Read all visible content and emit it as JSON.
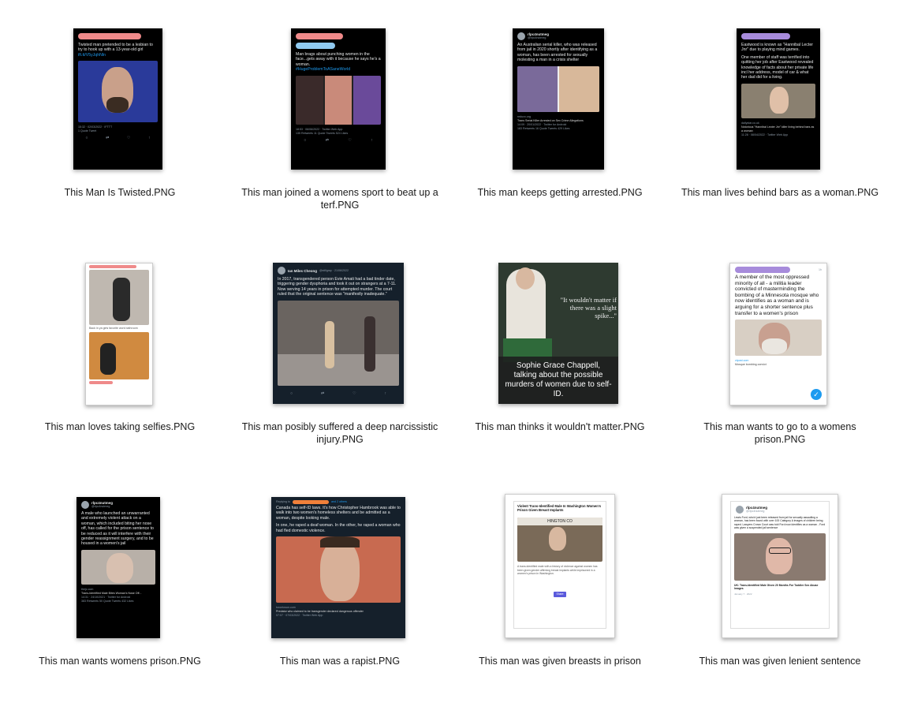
{
  "files": [
    {
      "label": "This Man Is Twisted.PNG",
      "tweet": "Twisted man pretended to be a lesbian to try to hook up with a 13-year-old girl",
      "link": "ift.tt/V5yJqhNln",
      "meta": "15:32 · 02/03/2022 · IFTTT",
      "stats": "1 Quote Tweet"
    },
    {
      "label": "This man joined a womens sport to beat up a terf.PNG",
      "tweet": "Man brags about punching women in the face...gets away with it because he says he's a woman.",
      "hashtag": "#HugeProblemToASaneWorld",
      "meta": "18:53 · 06/06/2022 · Twitter Web App",
      "stats": "135 Retweets  11 Quote Tweets  524 Likes"
    },
    {
      "label": "This man keeps getting arrested.PNG",
      "user": "rlpc4nutmeg",
      "handle": "@rlpc4nutmeg",
      "tweet": "An Australian serial killer, who was released from jail in 2020 shortly after identifying as a woman, has been arrested for sexually molesting a man in a crisis shelter",
      "source": "reduxx.org",
      "headline": "Trans Serial Killer Arrested on Sex Crime Allegations",
      "meta": "14:09 · 20/01/2022 · Twitter for Android",
      "stats": "183 Retweets  16 Quote Tweets  429 Likes"
    },
    {
      "label": "This man lives behind bars as a woman.PNG",
      "tweet": "Eastwood is known as \"Hannibal Lecter Jnr\" due to playing mind games.",
      "tweet2": "One member of staff was terrified into quitting her job after Eastwood revealed knowledge of facts about her private life incl her address, model of car & what her dad did for a living.",
      "source": "dailystar.co.uk",
      "headline": "Notorious \"Hannibal Lecter Jnr\" killer living behind bars as a woman",
      "meta": "11:28 · 08/04/2022 · Twitter Web App"
    },
    {
      "label": "This man loves taking selfies.PNG",
      "caption": "Back in ya girls favorite work bathroom"
    },
    {
      "label": "This man posibly suffered a deep narcissistic injury.PNG",
      "user": "Ian Miles Cheong",
      "handle": "@stillgray · 21/06/2022",
      "tweet": "In 2017, transgendered person Evie Amati had a bad tinder date, triggering gender dysphoria and took it out on strangers at a 7-11. Now serving 14 years in prison for attempted murder. The court ruled that the original sentence was \"manifestly inadequate.\""
    },
    {
      "label": "This man thinks it wouldn't matter.PNG",
      "quote": "\"It wouldn't matter if there was a slight spike...\"",
      "caption": "Sophie Grace Chappell, talking about the possible murders of women due to self-ID."
    },
    {
      "label": "This man wants to go to a womens prison.PNG",
      "time": "1h",
      "tweet": "A member of the most oppressed minority of all - a militia leader convicted of masterminding the bombing of a Minnesota mosque who now identifies as a woman and is arguing for a shorter sentence plus transfer to a women's prison",
      "source": "ctpost.com",
      "headline": "Mosque bombing convict"
    },
    {
      "label": "This man wants womens prison.PNG",
      "user": "rlpc4nutmeg",
      "handle": "@rlpc4nutmeg",
      "tweet": "A male who launched an unwarranted and extremely violent attack on a woman, which included biting her nose off, has called for the prison sentence to be reduced as it will interfere with their gender reassignment surgery, and to be housed in a women's jail",
      "source": "thejc.com",
      "headline": "Trans-Identified Male Bites Woman's Nose Off...",
      "meta": "14:31 · 24/10/2021 · Twitter for Android",
      "stats": "383 Retweets  50 Quote Tweets  432 Likes"
    },
    {
      "label": "This man was a rapist.PNG",
      "reply": "Replying to",
      "others": "and 2 others",
      "tweet": "Canada has self-ID laws. It's how Christopher Hambrook was able to walk into two women's homeless shelters and be admitted as a woman, despite looking male.",
      "tweet2": "In one, he raped a deaf woman. In the other, he raped a woman who had fled domestic violence.",
      "source": "torontosun.com",
      "headline": "Predator who claimed to be transgender declared dangerous offender",
      "meta": "07:07 · 07/03/2022 · Twitter Web App"
    },
    {
      "label": "This man was given breasts in prison",
      "headline": "Violent Trans-Identified Male In Washington Women's Prison Given Breast Implants",
      "sign": "HINGTON CO",
      "body": "A trans-identified male with a history of violence against women has been given gender affirming breast implants while imprisoned in a women's prison in Washington.",
      "button": "Share"
    },
    {
      "label": "This man was given lenient sentence",
      "user": "rlpc4nutmeg",
      "handle": "@rlpc4nutmeg",
      "tweet": "Lewis Ford, who'd just been released from jail for sexually assaulting a woman, has been found with over 100 Category A images of children being raped. Lawyers Crown Court was told Ford now identifies as a woman - Ford was given a suspended jail sentence",
      "headline": "UK: Trans-Identified Male Given 20 Months For Toddler Sex Abuse Images",
      "meta": "January 7 · 2022"
    }
  ],
  "colors": {
    "pink_scribble": "#ef8a8a",
    "purple_scribble": "#a78bdb",
    "blue_scribble": "#8fc9ef",
    "orange_scribble": "#f0803a",
    "tweet_dark": "#15202b",
    "link_blue": "#1d9bf0"
  }
}
